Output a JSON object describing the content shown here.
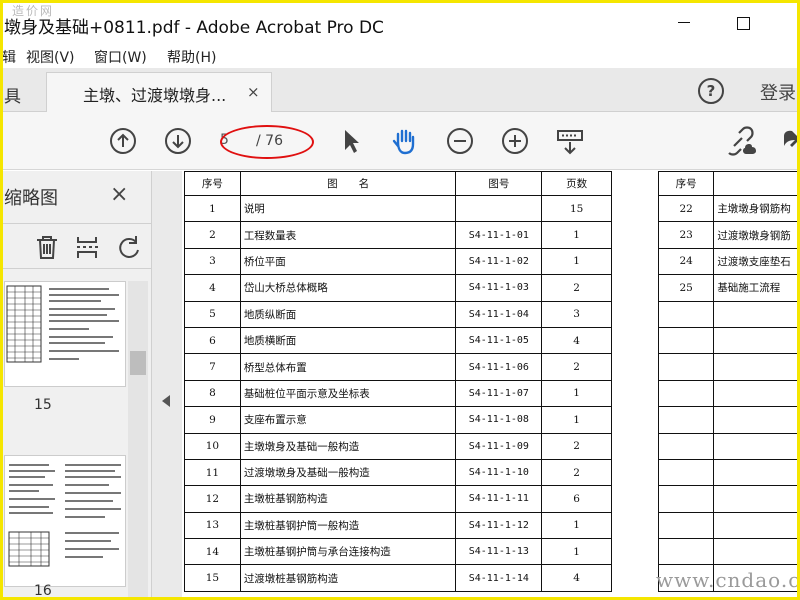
{
  "window": {
    "title": "墩身及基础+0811.pdf - Adobe Acrobat Pro DC",
    "corner_watermark": "造价网"
  },
  "menu": [
    {
      "label": "辑"
    },
    {
      "label": "视图(V)"
    },
    {
      "label": "窗口(W)"
    },
    {
      "label": "帮助(H)"
    }
  ],
  "tabs": {
    "stub_label": "具",
    "active_label": "主墩、过渡墩墩身...",
    "close_glyph": "×",
    "help_glyph": "?",
    "login_label": "登录"
  },
  "toolbar": {
    "icons": [
      "previous-page-icon",
      "next-page-icon",
      "select-arrow-icon",
      "hand-tool-icon",
      "zoom-out-icon",
      "zoom-in-icon",
      "fit-page-icon",
      "share-link-icon",
      "more-icon"
    ],
    "current_page": "5",
    "total_pages": "/ 76"
  },
  "sidepanel": {
    "title": "缩略图",
    "close_glyph": "×",
    "tools": [
      "delete-icon",
      "extract-icon",
      "rotate-icon"
    ],
    "thumb_labels": [
      "15",
      "16"
    ]
  },
  "table_left": {
    "headers": [
      "序号",
      "图　　名",
      "图号",
      "页数"
    ],
    "rows": [
      [
        "1",
        "说明",
        "",
        "15"
      ],
      [
        "2",
        "工程数量表",
        "S4-11-1-01",
        "1"
      ],
      [
        "3",
        "桥位平面",
        "S4-11-1-02",
        "1"
      ],
      [
        "4",
        "岱山大桥总体概略",
        "S4-11-1-03",
        "2"
      ],
      [
        "5",
        "地质纵断面",
        "S4-11-1-04",
        "3"
      ],
      [
        "6",
        "地质横断面",
        "S4-11-1-05",
        "4"
      ],
      [
        "7",
        "桥型总体布置",
        "S4-11-1-06",
        "2"
      ],
      [
        "8",
        "基础桩位平面示意及坐标表",
        "S4-11-1-07",
        "1"
      ],
      [
        "9",
        "支座布置示意",
        "S4-11-1-08",
        "1"
      ],
      [
        "10",
        "主墩墩身及基础一般构造",
        "S4-11-1-09",
        "2"
      ],
      [
        "11",
        "过渡墩墩身及基础一般构造",
        "S4-11-1-10",
        "2"
      ],
      [
        "12",
        "主墩桩基钢筋构造",
        "S4-11-1-11",
        "6"
      ],
      [
        "13",
        "主墩桩基钢护筒一般构造",
        "S4-11-1-12",
        "1"
      ],
      [
        "14",
        "主墩桩基钢护筒与承台连接构造",
        "S4-11-1-13",
        "1"
      ],
      [
        "15",
        "过渡墩桩基钢筋构造",
        "S4-11-1-14",
        "4"
      ]
    ]
  },
  "table_right": {
    "headers": [
      "序号",
      ""
    ],
    "rows": [
      [
        "22",
        "主墩墩身钢筋构"
      ],
      [
        "23",
        "过渡墩墩身钢筋"
      ],
      [
        "24",
        "过渡墩支座垫石"
      ],
      [
        "25",
        "基础施工流程"
      ],
      [
        "",
        ""
      ],
      [
        "",
        ""
      ],
      [
        "",
        ""
      ],
      [
        "",
        ""
      ],
      [
        "",
        ""
      ],
      [
        "",
        ""
      ],
      [
        "",
        ""
      ],
      [
        "",
        ""
      ],
      [
        "",
        ""
      ],
      [
        "",
        ""
      ],
      [
        "",
        ""
      ]
    ]
  },
  "bottom_watermark": "www.cndao.com",
  "colors": {
    "frame_border": "#f5e600",
    "annotation_ring": "#e01010"
  }
}
